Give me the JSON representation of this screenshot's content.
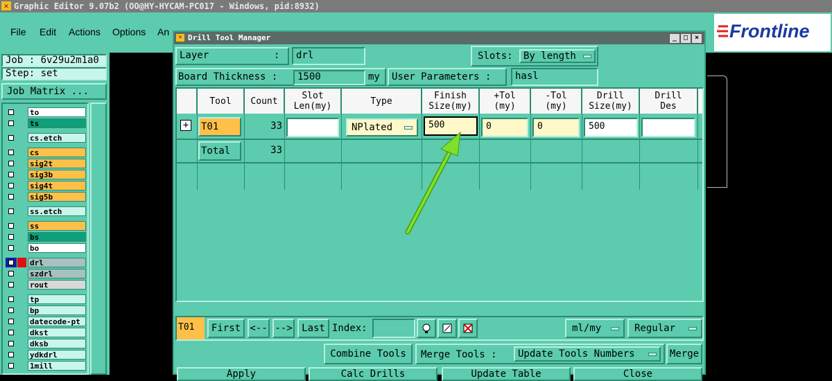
{
  "app": {
    "title": "Graphic Editor 9.07b2 (OO@HY-HYCAM-PC017 - Windows, pid:8932)"
  },
  "menu": {
    "items": [
      "File",
      "Edit",
      "Actions",
      "Options",
      "An"
    ]
  },
  "logo": {
    "text": "Frontline"
  },
  "job": {
    "job_label": "Job : 6v29u2m1a0",
    "step_label": "Step: set",
    "matrix_button": "Job Matrix ..."
  },
  "layers": [
    {
      "name": "to",
      "color": "#ffffff"
    },
    {
      "name": "ts",
      "color": "#0ea07a"
    },
    {
      "name": "cs.etch",
      "color": "#c8f5ec"
    },
    {
      "name": "cs",
      "color": "#ffc04a"
    },
    {
      "name": "sig2t",
      "color": "#ffc04a"
    },
    {
      "name": "sig3b",
      "color": "#ffc04a"
    },
    {
      "name": "sig4t",
      "color": "#ffc04a"
    },
    {
      "name": "sig5b",
      "color": "#ffc04a"
    },
    {
      "name": "ss.etch",
      "color": "#c8f5ec"
    },
    {
      "name": "ss",
      "color": "#ffc04a"
    },
    {
      "name": "bs",
      "color": "#0ea07a"
    },
    {
      "name": "bo",
      "color": "#ffffff"
    },
    {
      "name": "drl",
      "color": "#a8c0c0"
    },
    {
      "name": "szdrl",
      "color": "#a8c0c0"
    },
    {
      "name": "rout",
      "color": "#d8d8d8"
    },
    {
      "name": "tp",
      "color": "#c8f5ec"
    },
    {
      "name": "bp",
      "color": "#c8f5ec"
    },
    {
      "name": "datecode-pt",
      "color": "#c8f5ec"
    },
    {
      "name": "dkst",
      "color": "#c8f5ec"
    },
    {
      "name": "dksb",
      "color": "#c8f5ec"
    },
    {
      "name": "ydkdrl",
      "color": "#c8f5ec"
    },
    {
      "name": "1mill",
      "color": "#c8f5ec"
    }
  ],
  "dialog": {
    "title": "Drill Tool Manager",
    "layer_label": "Layer",
    "layer_colon": ":",
    "layer_value": "drl",
    "slots_label": "Slots:",
    "slots_value": "By length",
    "board_thickness_label": "Board Thickness :",
    "board_thickness_value": "1500",
    "board_thickness_unit": "my",
    "user_params_label": "User Parameters :",
    "user_params_value": "hasl",
    "columns": [
      {
        "line1": "Tool",
        "line2": ""
      },
      {
        "line1": "Count",
        "line2": ""
      },
      {
        "line1": "Slot",
        "line2": "Len(my)"
      },
      {
        "line1": "Type",
        "line2": ""
      },
      {
        "line1": "Finish",
        "line2": "Size(my)"
      },
      {
        "line1": "+Tol",
        "line2": "(my)"
      },
      {
        "line1": "-Tol",
        "line2": "(my)"
      },
      {
        "line1": "Drill",
        "line2": "Size(my)"
      },
      {
        "line1": "Drill",
        "line2": "Des"
      }
    ],
    "row": {
      "expand": "+",
      "tool": "T01",
      "count": "33",
      "slot_len": "",
      "type": "NPlated",
      "finish": "500",
      "plus_tol": "0",
      "minus_tol": "0",
      "drill_size": "500",
      "drill_des": ""
    },
    "total": {
      "label": "Total",
      "count": "33"
    },
    "nav": {
      "current": "T01",
      "first": "First",
      "prev": "<--",
      "next": "-->",
      "last": "Last",
      "index_label": "Index:",
      "index_value": "",
      "units": "ml/my",
      "mode": "Regular"
    },
    "tools": {
      "combine": "Combine Tools",
      "merge_label": "Merge Tools :",
      "update_numbers": "Update Tools Numbers",
      "merge": "Merge"
    },
    "bottom": {
      "apply": "Apply",
      "calc": "Calc Drills",
      "update_table": "Update Table",
      "close": "Close"
    }
  },
  "colors": {
    "teal": "#5ccbae",
    "highlight_orange": "#ffc04a",
    "input_yellow": "#fff8c8",
    "arrow_green": "#7ee02a"
  }
}
